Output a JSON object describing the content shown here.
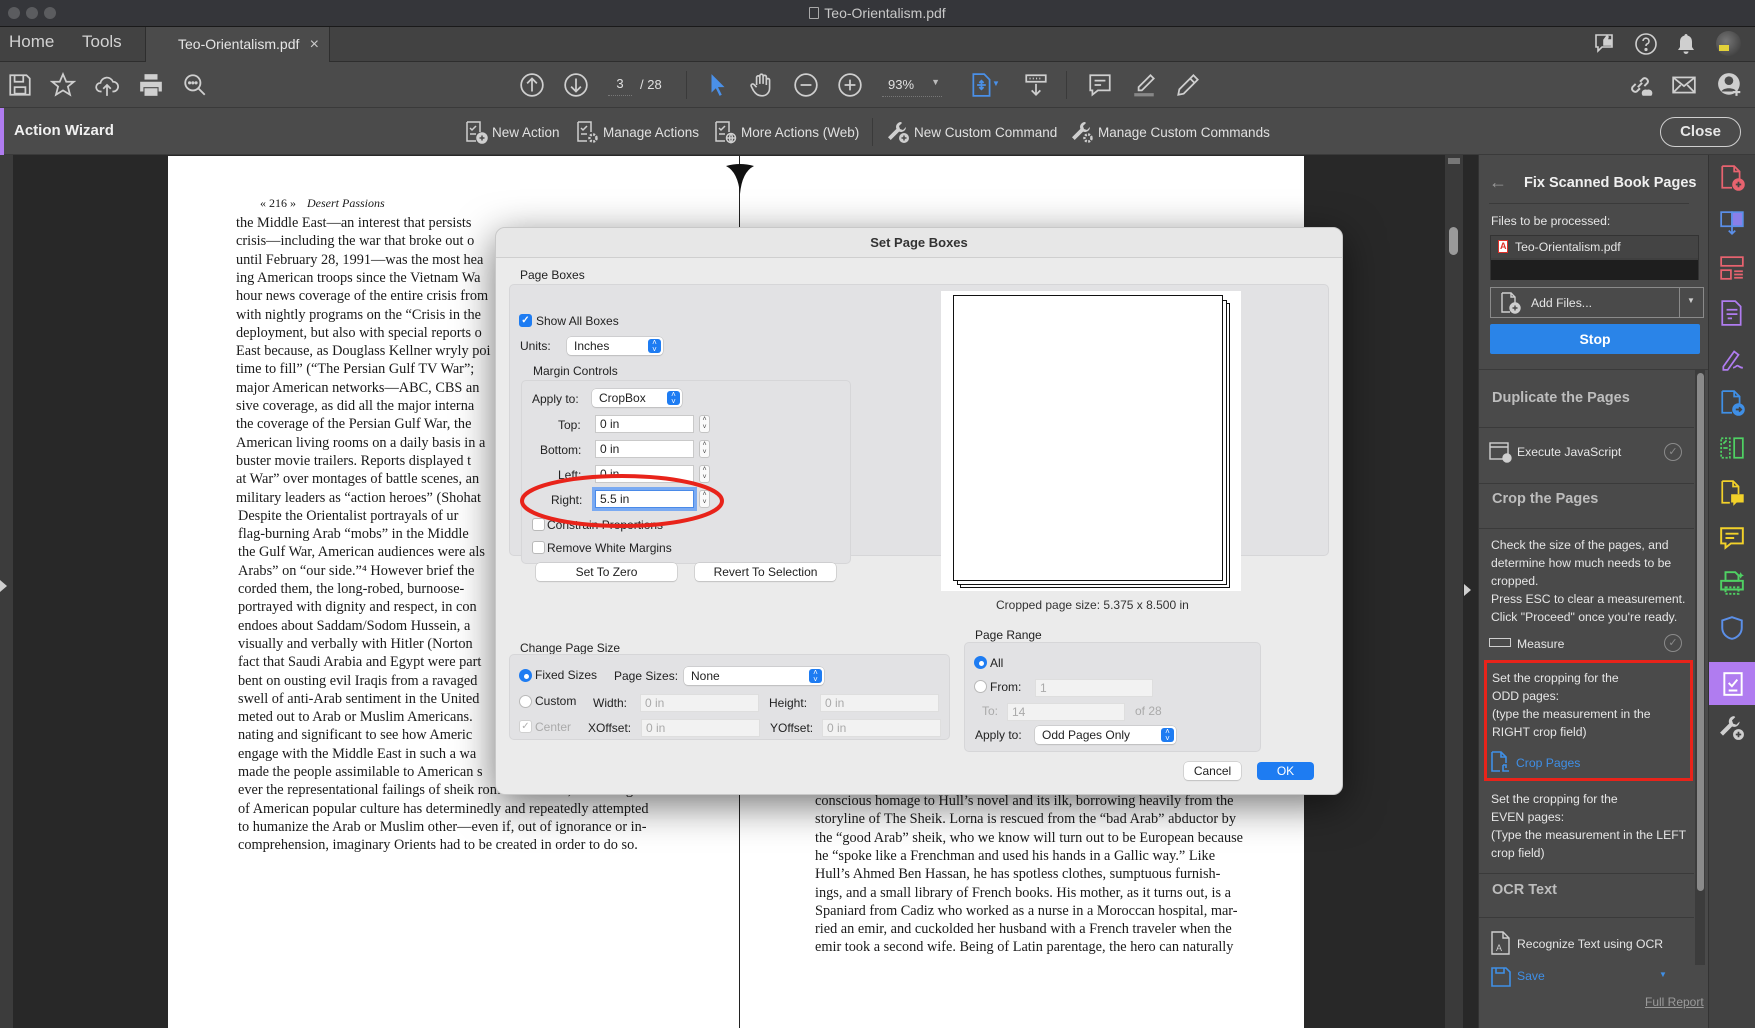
{
  "window": {
    "title": "Teo-Orientalism.pdf"
  },
  "tabs": {
    "home": "Home",
    "tools": "Tools",
    "document": "Teo-Orientalism.pdf",
    "close_glyph": "×"
  },
  "toolbar": {
    "page_current": "3",
    "page_total": "/ 28",
    "zoom": "93%",
    "icons_left": [
      "save-icon",
      "star-icon",
      "cloud-upload-icon",
      "print-icon",
      "search-icon"
    ],
    "icons_center": [
      "page-up-icon",
      "page-down-icon",
      "select-cursor-icon",
      "hand-icon",
      "zoom-out-icon",
      "zoom-in-icon",
      "fit-page-icon",
      "scroll-mode-icon",
      "comment-icon",
      "highlight-icon",
      "pencil-icon"
    ],
    "icons_right": [
      "share-link-icon",
      "email-icon",
      "add-user-icon"
    ],
    "header_icons": [
      "feedback-icon",
      "help-icon",
      "notifications-icon",
      "avatar"
    ]
  },
  "action_bar": {
    "title": "Action Wizard",
    "items": [
      "New Action",
      "Manage Actions",
      "More Actions (Web)",
      "New Custom Command",
      "Manage Custom Commands"
    ],
    "close_label": "Close",
    "accent": "#b07cf0"
  },
  "pdf": {
    "left_header_page": "« 216 »",
    "left_header_title": "Desert Passions",
    "left_lines": [
      "the Middle East—an interest that persists",
      "crisis—including the war that broke out o",
      "until February 28, 1991—was the most hea",
      "ing American troops since the Vietnam Wa",
      "hour news coverage of the entire crisis from",
      "with nightly programs on the “Crisis in the",
      "deployment, but also with special reports o",
      "East because, as Douglass Kellner wryly poi",
      "time to fill” (“The Persian Gulf TV War”; ",
      "major American networks—ABC, CBS an",
      "sive coverage, as did all the major interna",
      "the coverage of the Persian Gulf War, the",
      "American living rooms on a daily basis in a",
      "buster movie trailers. Reports displayed t",
      "at War” over montages of battle scenes, an",
      "military leaders as “action heroes” (Shohat",
      "    Despite the Orientalist portrayals of ur",
      "flag-burning Arab “mobs” in the Middle",
      "the Gulf War, American audiences were als",
      "Arabs” on “our side.”⁴ However brief the",
      "corded them, the long-robed, burnoose-",
      "portrayed with dignity and respect, in con",
      "endoes about Saddam/Sodom Hussein, a",
      "visually and verbally with Hitler (Norton",
      "fact that Saudi Arabia and Egypt were part",
      "bent on ousting evil Iraqis from a ravaged",
      "swell of anti-Arab sentiment in the United",
      "meted out to Arab or Muslim Americans.",
      "nating and significant to see how Americ",
      "engage with the Middle East in such a wa",
      "made the people assimilable to American s",
      "ever the representational failings of sheik romance novels, no other genre",
      "of American popular culture has determinedly and repeatedly attempted",
      "to humanize the Arab or Muslim other—even if, out of ignorance or in-",
      "comprehension, imaginary Orients had to be created in order to do so."
    ],
    "right_lines": [
      "conscious homage to Hull’s novel and its ilk, borrowing heavily from the",
      "storyline of The Sheik. Lorna is rescued from the “bad Arab” abductor by",
      "the “good Arab” sheik, who we know will turn out to be European because",
      "he “spoke like a Frenchman and used his hands in a Gallic way.” Like",
      "Hull’s Ahmed Ben Hassan, he has spotless clothes, sumptuous furnish-",
      "ings, and a small library of French books. His mother, as it turns out, is a",
      "Spaniard from Cadiz who worked as a nurse in a Moroccan hospital, mar-",
      "ried an emir, and cuckolded her husband with a French traveler when the",
      "emir took a second wife. Being of Latin parentage, the hero can naturally"
    ]
  },
  "dialog": {
    "title": "Set Page Boxes",
    "page_boxes_label": "Page Boxes",
    "show_all_boxes": {
      "label": "Show All Boxes",
      "checked": true
    },
    "units_label": "Units:",
    "units_value": "Inches",
    "margin_controls_label": "Margin Controls",
    "apply_to_label": "Apply to:",
    "apply_to_value": "CropBox",
    "top_label": "Top:",
    "top_value": "0 in",
    "bottom_label": "Bottom:",
    "bottom_value": "0 in",
    "left_label": "Left:",
    "left_value": "0 in",
    "right_label": "Right:",
    "right_value": "5.5 in",
    "constrain_label": "Constrain Proportions",
    "constrain_checked": false,
    "remove_white_label": "Remove White Margins",
    "remove_white_checked": false,
    "set_zero_label": "Set To Zero",
    "revert_label": "Revert To Selection",
    "cropped_size": "Cropped page size: 5.375 x 8.500 in",
    "change_page_size_label": "Change Page Size",
    "fixed_sizes_label": "Fixed Sizes",
    "fixed_sizes_selected": true,
    "page_sizes_label": "Page Sizes:",
    "page_sizes_value": "None",
    "custom_label": "Custom",
    "width_label": "Width:",
    "width_value": "0 in",
    "height_label": "Height:",
    "height_value": "0 in",
    "center_label": "Center",
    "center_checked": true,
    "xoffset_label": "XOffset:",
    "xoffset_value": "0 in",
    "yoffset_label": "YOffset:",
    "yoffset_value": "0 in",
    "page_range_label": "Page Range",
    "all_label": "All",
    "all_selected": true,
    "from_label": "From:",
    "from_value": "1",
    "to_label": "To:",
    "to_value": "14",
    "of_total": "of 28",
    "range_apply_label": "Apply to:",
    "range_apply_value": "Odd Pages Only",
    "cancel_label": "Cancel",
    "ok_label": "OK",
    "annotation_color": "#e8231a"
  },
  "right_panel": {
    "title": "Fix Scanned Book Pages",
    "files_label": "Files to be processed:",
    "file_name": "Teo-Orientalism.pdf",
    "add_files_label": "Add Files...",
    "stop_label": "Stop",
    "sections": {
      "duplicate": "Duplicate the Pages",
      "execute_js": "Execute JavaScript",
      "crop": "Crop the Pages",
      "crop_instructions": [
        "Check the size of the pages, and",
        "determine how much needs to be",
        "cropped.",
        "Press ESC to clear a measurement.",
        "Click \"Proceed\" once you're ready."
      ],
      "measure": "Measure",
      "odd_instructions": [
        "Set the cropping for the",
        "ODD pages:",
        "(type the measurement in the",
        "RIGHT crop field)"
      ],
      "crop_pages": "Crop Pages",
      "even_instructions": [
        "Set the cropping for the",
        "EVEN pages:",
        "(Type the measurement in the LEFT",
        "crop field)"
      ],
      "ocr": "OCR Text",
      "recognize": "Recognize Text using OCR",
      "save": "Save",
      "full_report": "Full Report"
    },
    "highlight_color": "#e8231a",
    "link_color": "#3f8fe6"
  },
  "icon_strip": [
    "create-pdf-icon",
    "combine-files-icon",
    "organize-pages-icon",
    "edit-pdf-icon",
    "fill-sign-icon",
    "export-pdf-icon",
    "compare-icon",
    "comment-file-icon",
    "comment-icon",
    "print-production-icon",
    "protect-icon",
    "action-wizard-icon",
    "more-tools-icon"
  ]
}
